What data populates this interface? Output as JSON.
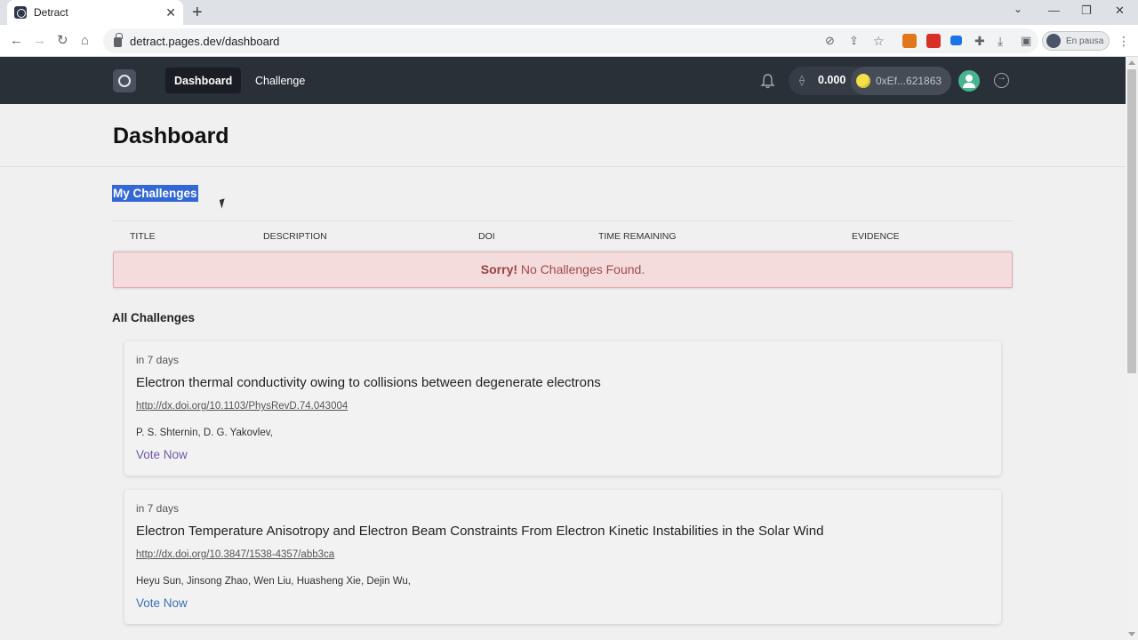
{
  "browser": {
    "tab_title": "Detract",
    "tab_close": "✕",
    "new_tab": "+",
    "url": "detract.pages.dev/dashboard",
    "profile_status": "En pausa",
    "min": "—",
    "max": "❐",
    "close": "✕"
  },
  "header": {
    "nav": [
      "Dashboard",
      "Challenge"
    ],
    "eth_balance": "0.000",
    "wallet_address": "0xEf...621863"
  },
  "page": {
    "title": "Dashboard",
    "my_challenges_title": "My Challenges",
    "all_challenges_title": "All Challenges"
  },
  "table": {
    "columns": [
      "TITLE",
      "DESCRIPTION",
      "DOI",
      "TIME REMAINING",
      "EVIDENCE"
    ]
  },
  "alert": {
    "strong": "Sorry!",
    "message": " No Challenges Found."
  },
  "challenges": [
    {
      "when": "in 7 days",
      "title": "Electron thermal conductivity owing to collisions between degenerate electrons",
      "doi": "http://dx.doi.org/10.1103/PhysRevD.74.043004",
      "authors": "P. S. Shternin, D. G. Yakovlev,",
      "vote": "Vote Now"
    },
    {
      "when": "in 7 days",
      "title": "Electron Temperature Anisotropy and Electron Beam Constraints From Electron Kinetic Instabilities in the Solar Wind",
      "doi": "http://dx.doi.org/10.3847/1538-4357/abb3ca",
      "authors": "Heyu Sun, Jinsong Zhao, Wen Liu, Huasheng Xie, Dejin Wu,",
      "vote": "Vote Now"
    }
  ],
  "colors": {
    "header_bg": "#2a3038",
    "selection": "#3367d6",
    "alert_bg": "#f4dcdc",
    "avatar": "#48b48e"
  }
}
